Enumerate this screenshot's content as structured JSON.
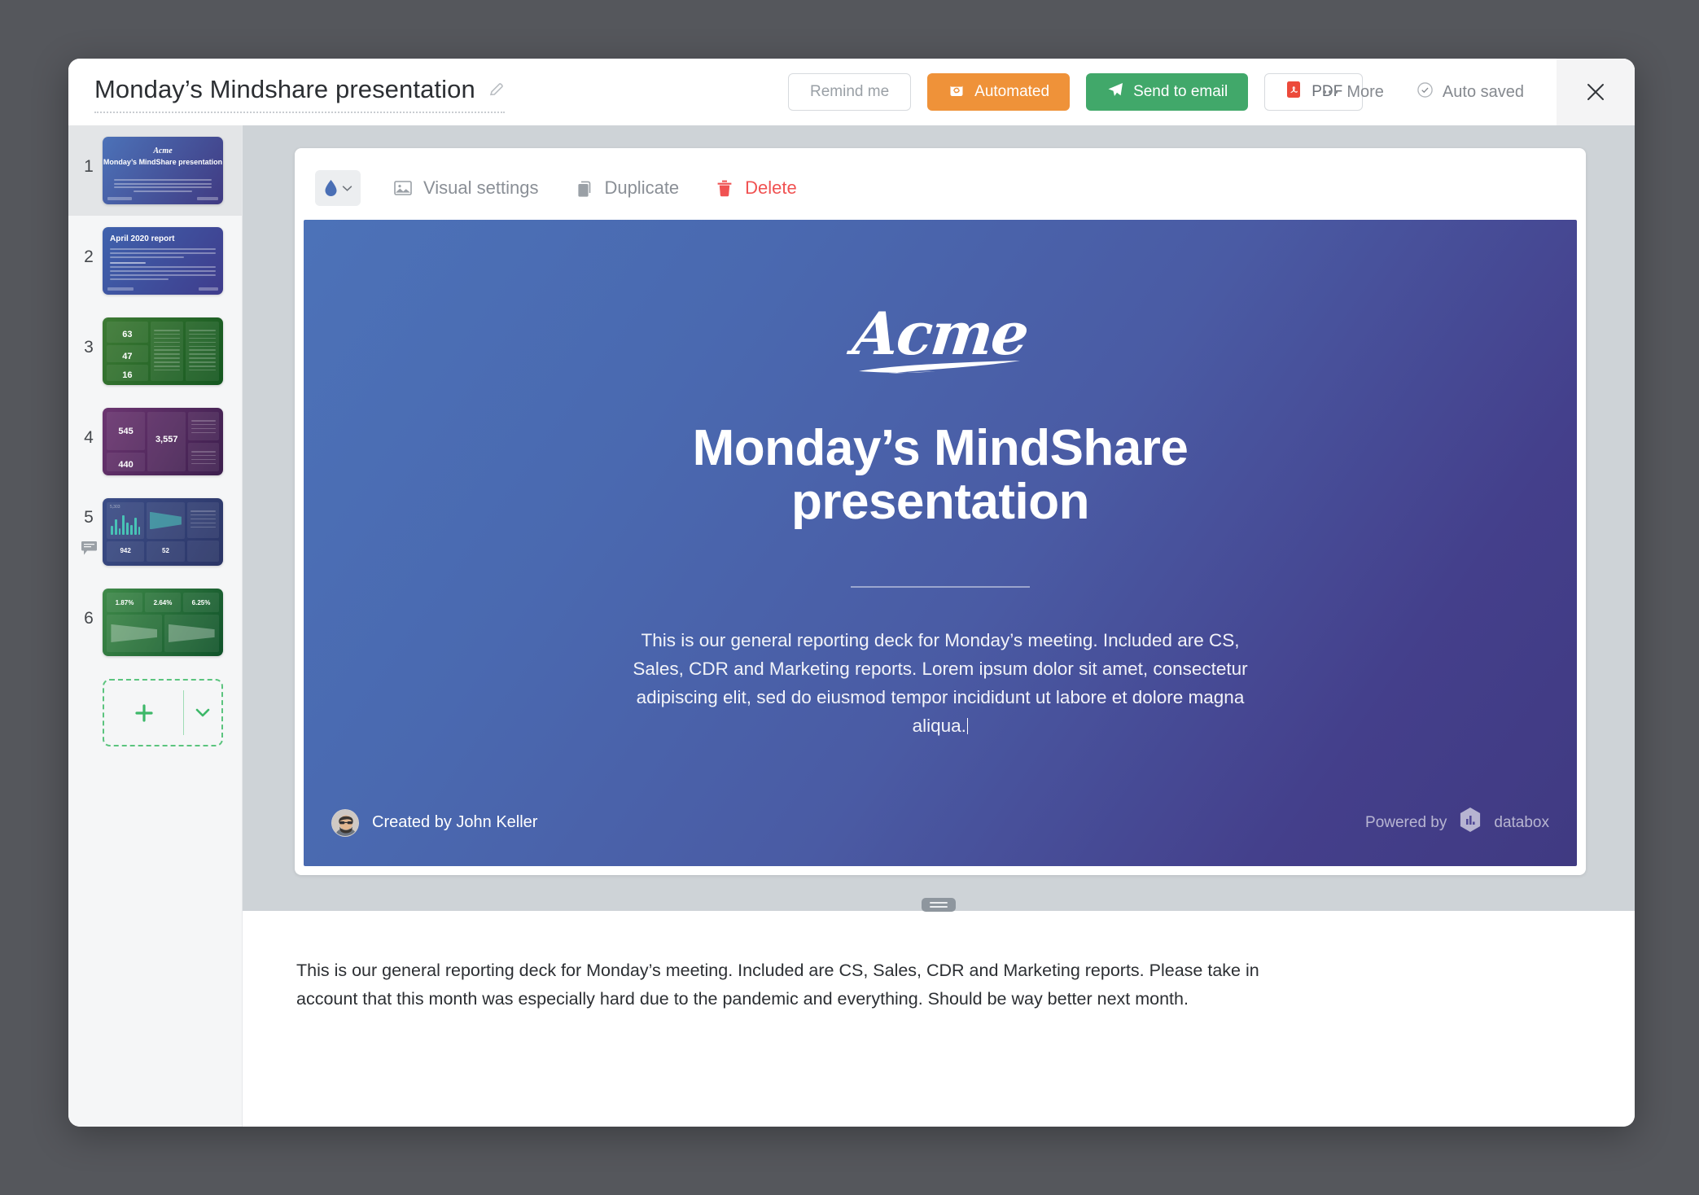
{
  "header": {
    "doc_title": "Monday’s Mindshare presentation",
    "edit_icon": "pencil-icon",
    "buttons": {
      "remind": "Remind me",
      "automated": "Automated",
      "send_to_email": "Send to email",
      "pdf": "PDF"
    },
    "more_label": "More",
    "autosave_label": "Auto saved",
    "close_icon": "close-icon"
  },
  "sidebar": {
    "slides": [
      {
        "number": "1",
        "selected": true,
        "has_comment": false,
        "type": "title",
        "title": "Monday’s MindShare presentation",
        "logo": "Acme"
      },
      {
        "number": "2",
        "selected": false,
        "has_comment": false,
        "type": "report",
        "heading": "April 2020 report"
      },
      {
        "number": "3",
        "selected": false,
        "has_comment": false,
        "type": "dash-green",
        "metrics": [
          "63",
          "47",
          "16"
        ]
      },
      {
        "number": "4",
        "selected": false,
        "has_comment": false,
        "type": "dash-purple",
        "metrics": [
          "545",
          "3,557",
          "440"
        ]
      },
      {
        "number": "5",
        "selected": false,
        "has_comment": true,
        "type": "dash-blue",
        "metrics": [
          "5,303",
          "942",
          "52"
        ]
      },
      {
        "number": "6",
        "selected": false,
        "has_comment": false,
        "type": "dash-funnel",
        "metrics": [
          "1.87%",
          "2.64%",
          "6.25%"
        ]
      }
    ],
    "add_slide": {
      "plus_icon": "plus-icon",
      "chevron_icon": "chevron-down-icon"
    }
  },
  "toolbar": {
    "color_picker": {
      "icon": "droplet-icon",
      "chevron": "chevron-down-icon"
    },
    "visual_settings": "Visual settings",
    "duplicate": "Duplicate",
    "delete": "Delete"
  },
  "slide": {
    "logo": "Acme",
    "title": "Monday’s MindShare presentation",
    "description": "This is our general reporting deck for Monday’s meeting. Included are CS, Sales, CDR and Marketing reports. Lorem ipsum dolor sit amet, consectetur adipiscing elit, sed do eiusmod tempor incididunt ut labore et dolore magna aliqua.",
    "author": "Created by John Keller",
    "powered_by": "Powered by",
    "brand": "databox"
  },
  "notes": {
    "text": "This is our general reporting deck for Monday’s meeting. Included are CS, Sales, CDR and Marketing reports. Please take in account that this month was especially hard due to the pandemic and everything. Should be way better next month."
  },
  "colors": {
    "accent_orange": "#ef9239",
    "accent_green": "#41a86a",
    "danger_red": "#f05252",
    "slide_gradient_start": "#4c72b8",
    "slide_gradient_end": "#403a82",
    "add_slide_green": "#5bc47e"
  }
}
